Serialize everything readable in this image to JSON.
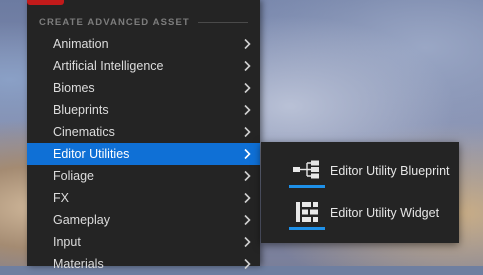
{
  "section": {
    "title": "CREATE ADVANCED ASSET"
  },
  "menu": {
    "items": [
      {
        "label": "Animation"
      },
      {
        "label": "Artificial Intelligence"
      },
      {
        "label": "Biomes"
      },
      {
        "label": "Blueprints"
      },
      {
        "label": "Cinematics"
      },
      {
        "label": "Editor Utilities",
        "selected": true
      },
      {
        "label": "Foliage"
      },
      {
        "label": "FX"
      },
      {
        "label": "Gameplay"
      },
      {
        "label": "Input"
      },
      {
        "label": "Materials"
      }
    ]
  },
  "submenu": {
    "items": [
      {
        "label": "Editor Utility Blueprint",
        "icon": "blueprint-graph-icon"
      },
      {
        "label": "Editor Utility Widget",
        "icon": "widget-layout-icon"
      }
    ]
  },
  "colors": {
    "menu_bg": "#242424",
    "selected": "#0f70d6",
    "accent_bar": "#1e90e8",
    "brand_red": "#c21a1a"
  }
}
